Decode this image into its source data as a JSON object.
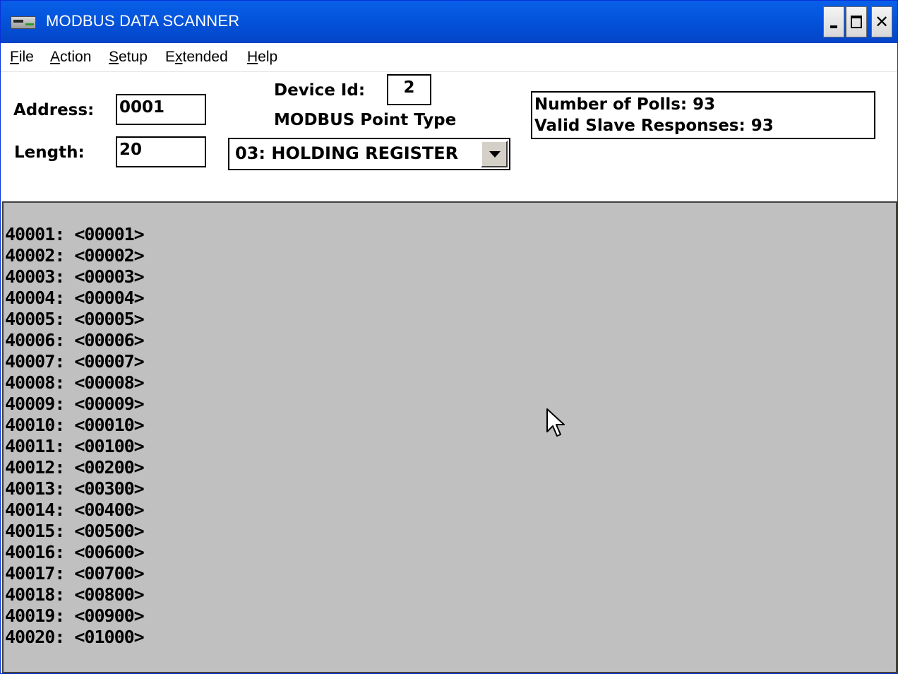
{
  "window": {
    "title": "MODBUS DATA SCANNER",
    "icon": "app-icon",
    "caption_buttons": [
      "minimize-icon",
      "maximize-icon",
      "close-icon"
    ],
    "title_color": "#0558e0"
  },
  "menu": {
    "items": [
      {
        "mnemonic": "F",
        "rest": "ile"
      },
      {
        "mnemonic": "A",
        "rest": "ction"
      },
      {
        "mnemonic": "S",
        "rest": "etup"
      },
      {
        "pre": "E",
        "mnemonic": "x",
        "rest": "tended"
      },
      {
        "mnemonic": "H",
        "rest": "elp"
      }
    ]
  },
  "form": {
    "address_label": "Address:",
    "address_value": "0001",
    "length_label": "Length:",
    "length_value": "20",
    "device_id_label": "Device Id:",
    "device_id_value": "2",
    "point_type_label": "MODBUS Point Type",
    "point_type_value": "03: HOLDING REGISTER"
  },
  "stats": {
    "polls": "Number of Polls: 93",
    "valid_responses": "Valid Slave Responses: 93"
  },
  "registers": [
    "40001: <00001>",
    "40002: <00002>",
    "40003: <00003>",
    "40004: <00004>",
    "40005: <00005>",
    "40006: <00006>",
    "40007: <00007>",
    "40008: <00008>",
    "40009: <00009>",
    "40010: <00010>",
    "40011: <00100>",
    "40012: <00200>",
    "40013: <00300>",
    "40014: <00400>",
    "40015: <00500>",
    "40016: <00600>",
    "40017: <00700>",
    "40018: <00800>",
    "40019: <00900>",
    "40020: <01000>"
  ],
  "colors": {
    "panel_background": "#c0c0c0",
    "window_background": "#ffffff"
  },
  "cursor_icon": "mouse-pointer-icon"
}
